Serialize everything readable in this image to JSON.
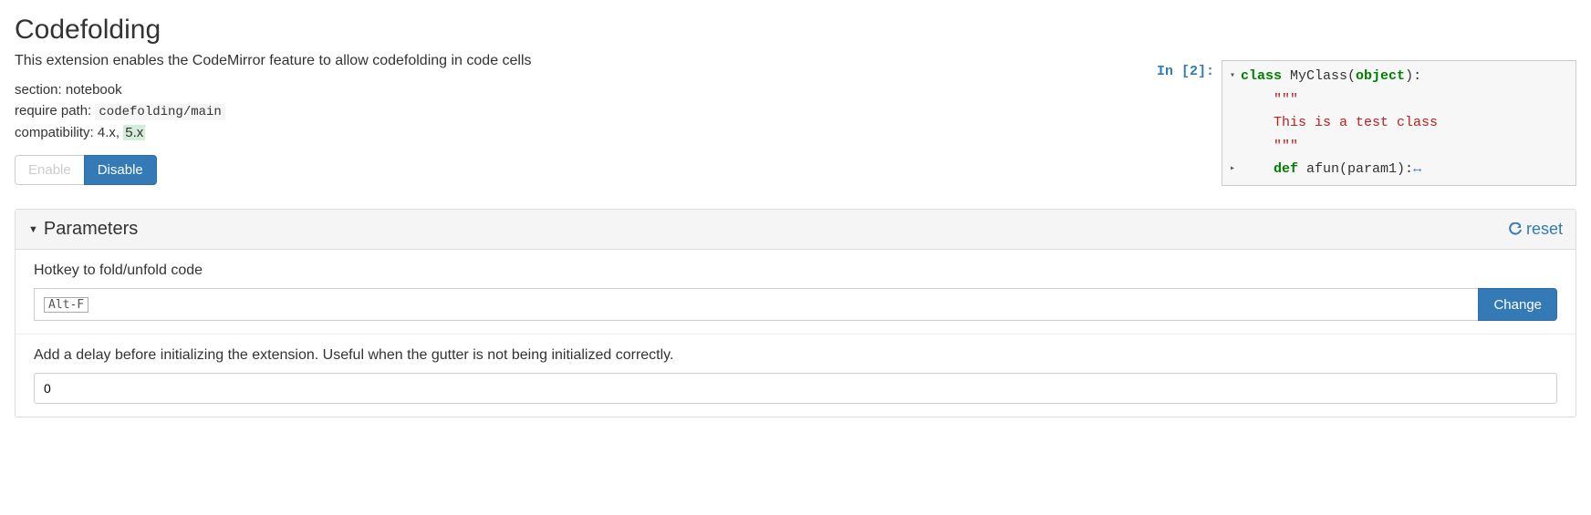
{
  "title": "Codefolding",
  "description": "This extension enables the CodeMirror feature to allow codefolding in code cells",
  "meta": {
    "section_label": "section:",
    "section_value": "notebook",
    "require_label": "require path:",
    "require_value": "codefolding/main",
    "compat_label": "compatibility:",
    "compat_v1": "4.x,",
    "compat_v2": "5.x"
  },
  "buttons": {
    "enable": "Enable",
    "disable": "Disable"
  },
  "preview": {
    "prompt": "In [2]:",
    "line1_kw": "class",
    "line1_name": " MyClass(",
    "line1_obj": "object",
    "line1_end": "):",
    "line2": "    \"\"\"",
    "line3": "    This is a test class",
    "line4": "    \"\"\"",
    "line5_kw": "    def",
    "line5_rest": " afun(param1):",
    "line5_fold": "↔"
  },
  "panel": {
    "heading": "Parameters",
    "reset": "reset"
  },
  "params": {
    "hotkey_label": "Hotkey to fold/unfold code",
    "hotkey_value": "Alt-F",
    "change_button": "Change",
    "delay_label": "Add a delay before initializing the extension. Useful when the gutter is not being initialized correctly.",
    "delay_value": "0"
  }
}
